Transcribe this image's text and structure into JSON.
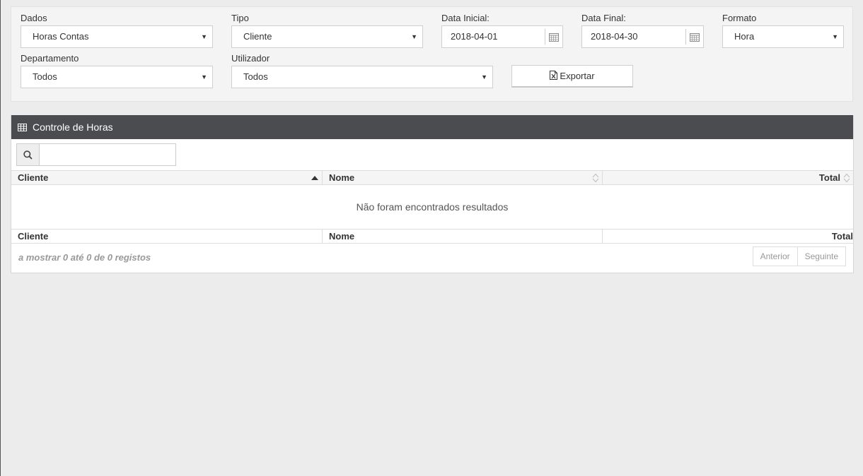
{
  "filters": {
    "dados": {
      "label": "Dados",
      "value": "Horas Contas"
    },
    "tipo": {
      "label": "Tipo",
      "value": "Cliente"
    },
    "data_inicial": {
      "label": "Data Inicial:",
      "value": "2018-04-01"
    },
    "data_final": {
      "label": "Data Final:",
      "value": "2018-04-30"
    },
    "formato": {
      "label": "Formato",
      "value": "Hora"
    },
    "departamento": {
      "label": "Departamento",
      "value": "Todos"
    },
    "utilizador": {
      "label": "Utilizador",
      "value": "Todos"
    },
    "export_label": "Exportar"
  },
  "panel": {
    "title": "Controle de Horas",
    "search": {
      "value": "",
      "placeholder": ""
    },
    "columns": [
      "Cliente",
      "Nome",
      "Total"
    ],
    "empty_message": "Não foram encontrados resultados",
    "info": "a mostrar 0 até 0 de 0 registos",
    "pager": {
      "prev": "Anterior",
      "next": "Seguinte"
    }
  },
  "colors": {
    "header_bg": "#4a4c4f",
    "page_bg": "#ececec",
    "panel_bg": "#f4f4f4"
  }
}
